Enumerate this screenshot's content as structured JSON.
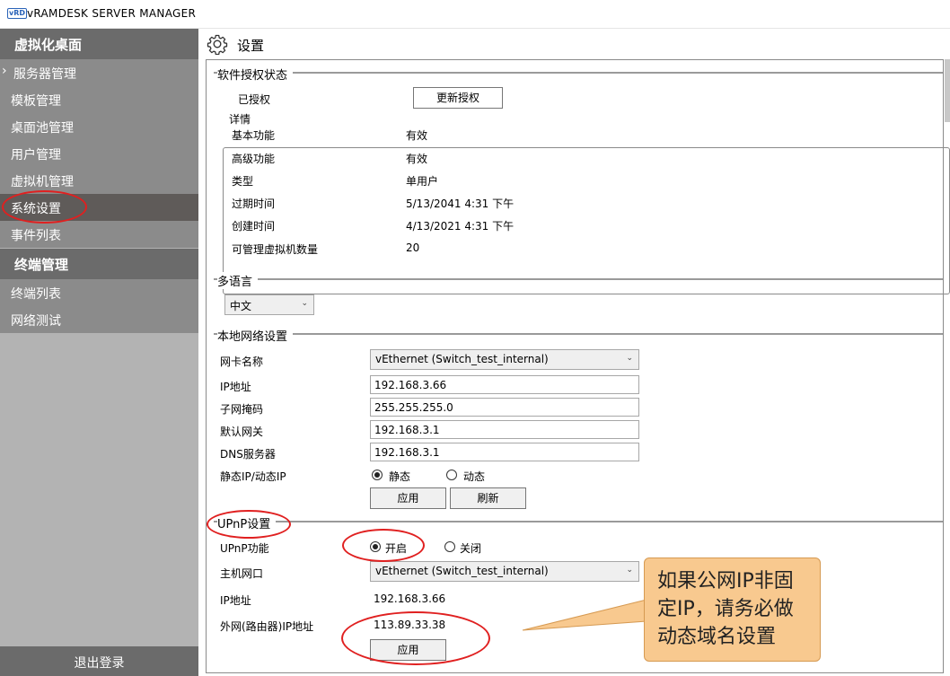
{
  "window": {
    "logo": "vRD",
    "title": "vRAMDESK SERVER MANAGER"
  },
  "sidebar": {
    "section_virtual": "虚拟化桌面",
    "items_virtual": [
      {
        "label": "服务器管理"
      },
      {
        "label": "模板管理"
      },
      {
        "label": "桌面池管理"
      },
      {
        "label": "用户管理"
      },
      {
        "label": "虚拟机管理"
      },
      {
        "label": "系统设置"
      },
      {
        "label": "事件列表"
      }
    ],
    "section_terminal": "终端管理",
    "items_terminal": [
      {
        "label": "终端列表"
      },
      {
        "label": "网络测试"
      }
    ],
    "logout": "退出登录"
  },
  "page": {
    "title": "设置",
    "icon": "gear-icon"
  },
  "license": {
    "group_title": "软件授权状态",
    "status": "已授权",
    "update_button": "更新授权",
    "details_title": "详情",
    "rows": [
      {
        "label": "基本功能",
        "value": "有效"
      },
      {
        "label": "高级功能",
        "value": "有效"
      },
      {
        "label": "类型",
        "value": "单用户"
      },
      {
        "label": "过期时间",
        "value": "5/13/2041 4:31 下午"
      },
      {
        "label": "创建时间",
        "value": "4/13/2021 4:31 下午"
      },
      {
        "label": "可管理虚拟机数量",
        "value": "20"
      }
    ]
  },
  "language": {
    "group_title": "多语言",
    "selected": "中文"
  },
  "network": {
    "group_title": "本地网络设置",
    "nic_label": "网卡名称",
    "nic_value": "vEthernet (Switch_test_internal)",
    "ip_label": "IP地址",
    "ip_value": "192.168.3.66",
    "mask_label": "子网掩码",
    "mask_value": "255.255.255.0",
    "gateway_label": "默认网关",
    "gateway_value": "192.168.3.1",
    "dns_label": "DNS服务器",
    "dns_value": "192.168.3.1",
    "mode_label": "静态IP/动态IP",
    "static_label": "静态",
    "dynamic_label": "动态",
    "apply_button": "应用",
    "refresh_button": "刷新"
  },
  "upnp": {
    "group_title": "UPnP设置",
    "function_label": "UPnP功能",
    "on_label": "开启",
    "off_label": "关闭",
    "host_nic_label": "主机网口",
    "host_nic_value": "vEthernet (Switch_test_internal)",
    "ip_label": "IP地址",
    "ip_value": "192.168.3.66",
    "wan_label": "外网(路由器)IP地址",
    "wan_value": "113.89.33.38",
    "apply_button": "应用"
  },
  "callout": {
    "text_line1": "如果公网IP非固",
    "text_line2": "定IP，请务必做",
    "text_line3": "动态域名设置"
  },
  "colors": {
    "highlight": "#e02020",
    "callout_bg": "#f8c98f",
    "sidebar_header": "#6b6b6b",
    "sidebar_item": "#8b8b8b"
  }
}
